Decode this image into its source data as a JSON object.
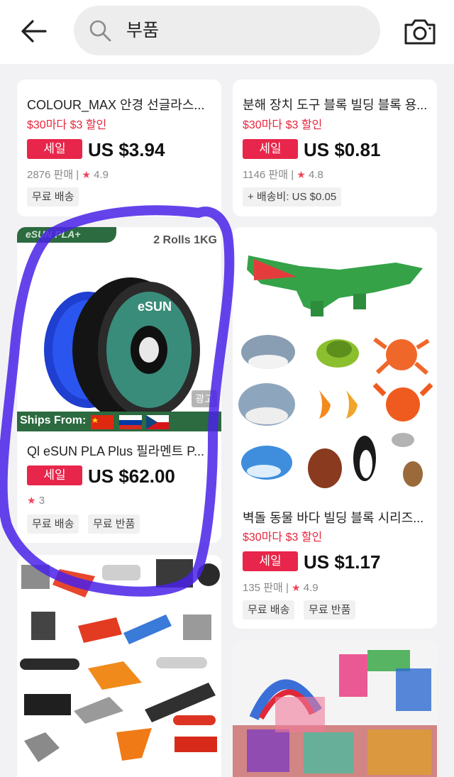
{
  "search": {
    "query": "부품"
  },
  "cards": [
    {
      "title": "COLOUR_MAX 안경 선글라스...",
      "promo": "$30마다 $3 할인",
      "sale_label": "세일",
      "price": "US $3.94",
      "sold": "2876 판매",
      "rating": "4.9",
      "tags": [
        "무료 배송"
      ]
    },
    {
      "title": "분해 장치 도구 블록 빌딩 블록 용...",
      "promo": "$30마다 $3 할인",
      "sale_label": "세일",
      "price": "US $0.81",
      "sold": "1146 판매",
      "rating": "4.8",
      "tags": [
        "+ 배송비: US $0.05"
      ]
    },
    {
      "brand_badge": "eSUN PLA+",
      "rolls_label": "2 Rolls 1KG",
      "ships_from": "Ships From:",
      "ad_label": "광고",
      "title": "Ql eSUN PLA Plus 필라멘트 P...",
      "sale_label": "세일",
      "price": "US $62.00",
      "rating": "3",
      "tags": [
        "무료 배송",
        "무료 반품"
      ]
    },
    {
      "title": "벽돌 동물 바다 빌딩 블록 시리즈...",
      "promo": "$30마다 $3 할인",
      "sale_label": "세일",
      "price": "US $1.17",
      "sold": "135 판매",
      "rating": "4.9",
      "tags": [
        "무료 배송",
        "무료 반품"
      ]
    }
  ],
  "colors": {
    "sale": "#e8254a",
    "promo": "#e6243a",
    "annotation": "#4a22e8"
  },
  "icons": [
    "back-arrow-icon",
    "search-icon",
    "camera-icon",
    "star-icon"
  ]
}
